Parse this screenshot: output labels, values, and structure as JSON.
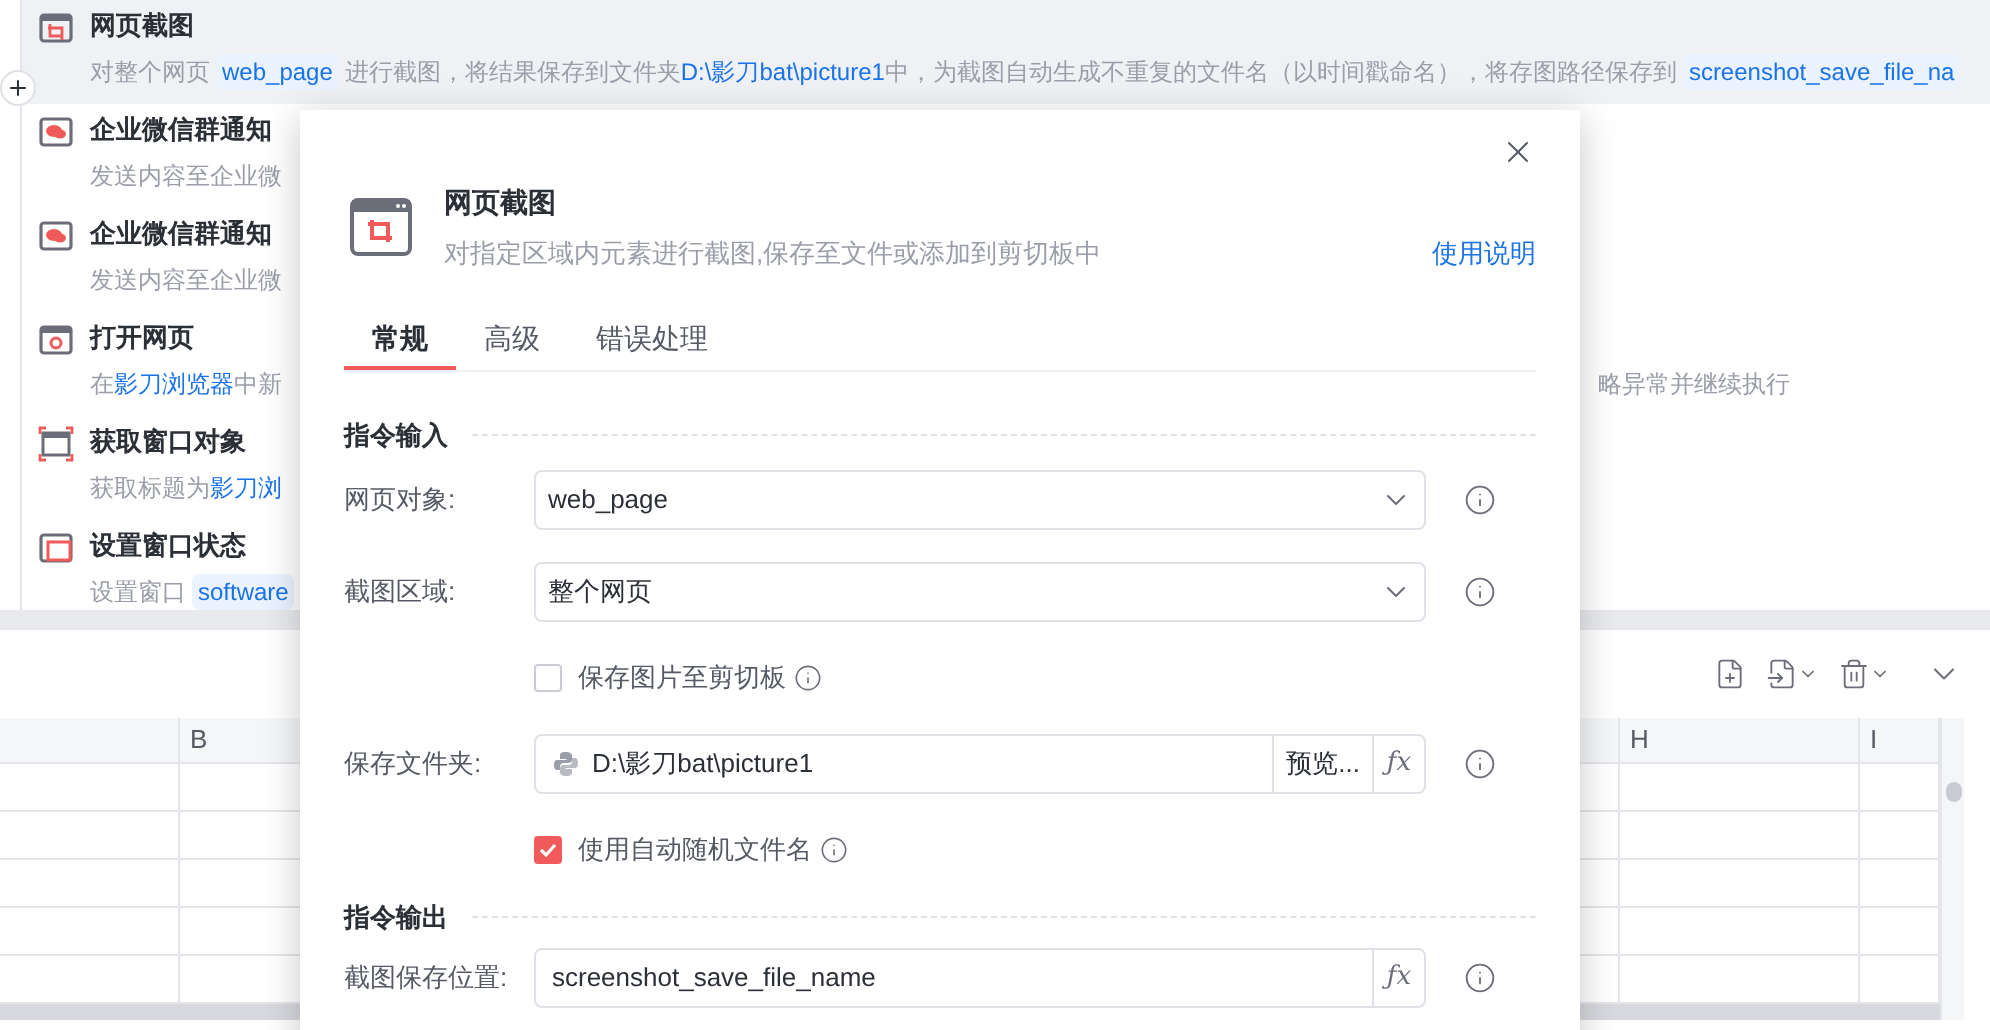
{
  "steps": [
    {
      "kind": "crop",
      "title": "网页截图",
      "selected": true,
      "description": [
        {
          "kind": "text",
          "text": "对整个网页"
        },
        {
          "kind": "chip",
          "text": "web_page"
        },
        {
          "kind": "text",
          "text": "进行截图，将结果保存到文件夹"
        },
        {
          "kind": "link",
          "text": "D:\\影刀bat\\picture1"
        },
        {
          "kind": "text",
          "text": "中，为截图自动生成不重复的文件名（以时间戳命名），将存图路径保存到"
        },
        {
          "kind": "chip",
          "text": "screenshot_save_file_na"
        }
      ]
    },
    {
      "kind": "chat",
      "title": "企业微信群通知",
      "selected": false,
      "description": [
        {
          "kind": "text",
          "text": "发送内容至企业微"
        }
      ]
    },
    {
      "kind": "chat",
      "title": "企业微信群通知",
      "selected": false,
      "description": [
        {
          "kind": "text",
          "text": "发送内容至企业微"
        }
      ]
    },
    {
      "kind": "browser",
      "title": "打开网页",
      "selected": false,
      "description": [
        {
          "kind": "text",
          "text": "在"
        },
        {
          "kind": "link",
          "text": "影刀浏览器"
        },
        {
          "kind": "text",
          "text": "中新"
        }
      ],
      "description_tail": "略异常并继续执行"
    },
    {
      "kind": "window-select",
      "title": "获取窗口对象",
      "selected": false,
      "description": [
        {
          "kind": "text",
          "text": "获取标题为"
        },
        {
          "kind": "link",
          "text": "影刀浏"
        }
      ]
    },
    {
      "kind": "window-state",
      "title": "设置窗口状态",
      "selected": false,
      "description": [
        {
          "kind": "text",
          "text": "设置窗口"
        },
        {
          "kind": "chip",
          "text": "software"
        }
      ]
    }
  ],
  "sheet": {
    "columns": [
      {
        "label": "B"
      },
      {
        "label": "H"
      },
      {
        "label": "I"
      }
    ]
  },
  "dialog": {
    "title": "网页截图",
    "subtitle": "对指定区域内元素进行截图,保存至文件或添加到剪切板中",
    "help_link": "使用说明",
    "tabs": [
      {
        "label": "常规",
        "selected": true
      },
      {
        "label": "高级",
        "selected": false
      },
      {
        "label": "错误处理",
        "selected": false
      }
    ],
    "sections": [
      {
        "title": "指令输入",
        "fields": [
          {
            "kind": "select",
            "label": "网页对象:",
            "value": "web_page"
          },
          {
            "kind": "select",
            "label": "截图区域:",
            "value": "整个网页"
          },
          {
            "kind": "checkbox",
            "label": "保存图片至剪切板",
            "checked": false
          },
          {
            "kind": "file",
            "label": "保存文件夹:",
            "value": "D:\\影刀bat\\picture1",
            "button": "预览...",
            "fx": "ƒx"
          },
          {
            "kind": "checkbox",
            "label": "使用自动随机文件名",
            "checked": true
          }
        ]
      },
      {
        "title": "指令输出",
        "fields": [
          {
            "kind": "text",
            "label": "截图保存位置:",
            "value": "screenshot_save_file_name",
            "fx": "ƒx"
          }
        ]
      }
    ]
  }
}
